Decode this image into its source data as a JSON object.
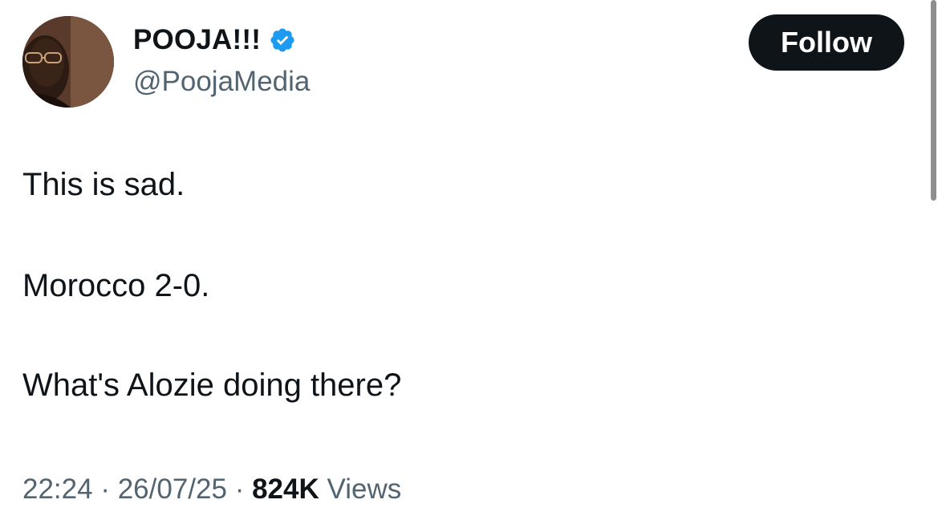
{
  "author": {
    "display_name": "POOJA!!!",
    "handle": "@PoojaMedia",
    "verified": true,
    "verified_badge_color": "#1d9bf0",
    "avatar_icon": "profile-photo"
  },
  "follow_button": {
    "label": "Follow",
    "bg_color": "#0f1419",
    "text_color": "#ffffff"
  },
  "tweet": {
    "lines": [
      "This is sad.",
      "Morocco 2-0.",
      "What's Alozie doing there?"
    ]
  },
  "meta": {
    "time": "22:24",
    "separator": "·",
    "date": "26/07/25",
    "views_count": "824K",
    "views_label": "Views"
  }
}
